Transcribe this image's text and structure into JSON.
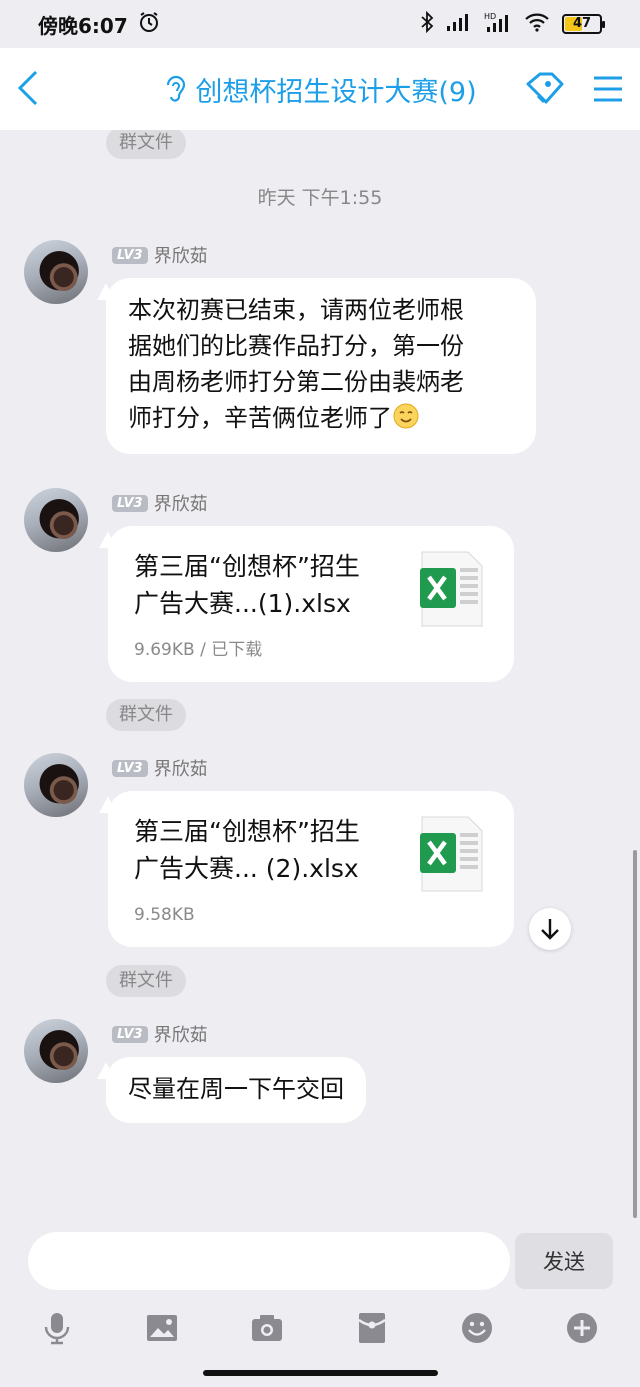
{
  "status_bar": {
    "time": "傍晚6:07",
    "battery_level": "47",
    "battery_fraction": 0.47,
    "icons": [
      "alarm-icon",
      "bluetooth-icon",
      "signal-icon",
      "hd-signal-icon",
      "wifi-icon",
      "battery-icon"
    ]
  },
  "header": {
    "title": "创想杯招生设计大赛(9)",
    "accent_color": "#1c9fe8",
    "icons": [
      "back-icon",
      "ear-icon",
      "group-tag-icon",
      "menu-icon"
    ]
  },
  "messages": [
    {
      "type": "tag",
      "label": "群文件"
    },
    {
      "type": "timestamp",
      "text": "昨天 下午1:55"
    },
    {
      "type": "text",
      "level": "LV3",
      "sender": "界欣茹",
      "lines": [
        "本次初赛已结束，请两位老师根",
        "据她们的比赛作品打分，第一份",
        "由周杨老师打分第二份由裴炳老",
        "师打分，辛苦俩位老师了"
      ],
      "emoji": "smile-emoji"
    },
    {
      "type": "file",
      "level": "LV3",
      "sender": "界欣茹",
      "file_lines": [
        "第三届“创想杯”招生",
        "广告大赛...(1).xlsx"
      ],
      "meta": "9.69KB / 已下载"
    },
    {
      "type": "tag",
      "label": "群文件"
    },
    {
      "type": "file",
      "level": "LV3",
      "sender": "界欣茹",
      "file_lines": [
        "第三届“创想杯”招生",
        "广告大赛... (2).xlsx"
      ],
      "meta": "9.58KB"
    },
    {
      "type": "tag",
      "label": "群文件"
    },
    {
      "type": "text",
      "level": "LV3",
      "sender": "界欣茹",
      "lines": [
        "尽量在周一下午交回"
      ]
    }
  ],
  "composer": {
    "input_value": "",
    "send_label": "发送"
  },
  "toolbar": {
    "icons": [
      "microphone-icon",
      "image-icon",
      "camera-icon",
      "red-packet-icon",
      "emoji-icon",
      "plus-icon"
    ]
  }
}
